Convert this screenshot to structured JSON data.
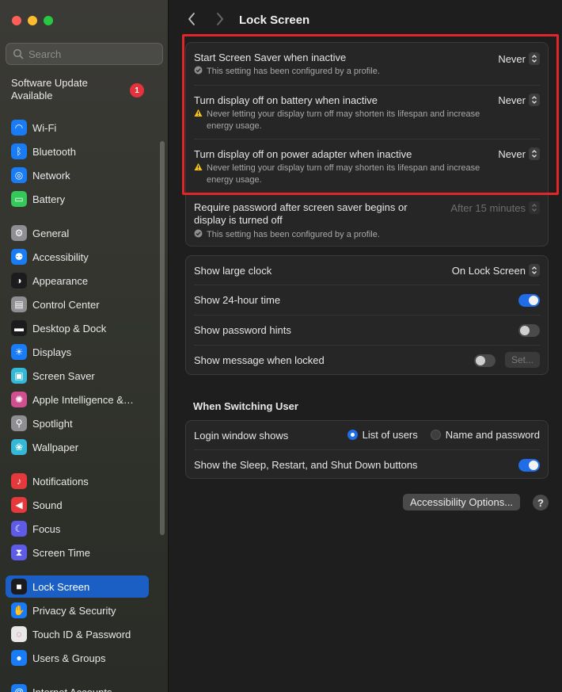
{
  "window": {
    "title": "Lock Screen"
  },
  "search": {
    "placeholder": "Search"
  },
  "software_update": {
    "label": "Software Update Available",
    "badge_count": "1"
  },
  "sidebar": {
    "items": [
      {
        "label": "Wi-Fi",
        "icon": "wifi-icon",
        "color": "#1a7cf5"
      },
      {
        "label": "Bluetooth",
        "icon": "bluetooth-icon",
        "color": "#1a7cf5"
      },
      {
        "label": "Network",
        "icon": "globe-icon",
        "color": "#1a7cf5"
      },
      {
        "label": "Battery",
        "icon": "battery-icon",
        "color": "#34c759"
      },
      {
        "label": "General",
        "icon": "gear-icon",
        "color": "#8e8e93"
      },
      {
        "label": "Accessibility",
        "icon": "accessibility-icon",
        "color": "#1a7cf5"
      },
      {
        "label": "Appearance",
        "icon": "appearance-icon",
        "color": "#1c1c1e"
      },
      {
        "label": "Control Center",
        "icon": "control-center-icon",
        "color": "#8e8e93"
      },
      {
        "label": "Desktop & Dock",
        "icon": "dock-icon",
        "color": "#1c1c1e"
      },
      {
        "label": "Displays",
        "icon": "sun-icon",
        "color": "#1a7cf5"
      },
      {
        "label": "Screen Saver",
        "icon": "screen-saver-icon",
        "color": "#35b8d6"
      },
      {
        "label": "Apple Intelligence &…",
        "icon": "apple-intelligence-icon",
        "color": "#d0508f"
      },
      {
        "label": "Spotlight",
        "icon": "magnifier-icon",
        "color": "#8e8e93"
      },
      {
        "label": "Wallpaper",
        "icon": "flower-icon",
        "color": "#35b8d6"
      },
      {
        "label": "Notifications",
        "icon": "bell-icon",
        "color": "#e5393b"
      },
      {
        "label": "Sound",
        "icon": "speaker-icon",
        "color": "#e5393b"
      },
      {
        "label": "Focus",
        "icon": "moon-icon",
        "color": "#5e5ce6"
      },
      {
        "label": "Screen Time",
        "icon": "hourglass-icon",
        "color": "#5e5ce6"
      },
      {
        "label": "Lock Screen",
        "icon": "lock-icon",
        "color": "#1c1c1e"
      },
      {
        "label": "Privacy & Security",
        "icon": "hand-icon",
        "color": "#1a7cf5"
      },
      {
        "label": "Touch ID & Password",
        "icon": "fingerprint-icon",
        "color": "#e8e8e8"
      },
      {
        "label": "Users & Groups",
        "icon": "users-icon",
        "color": "#1a7cf5"
      },
      {
        "label": "Internet Accounts",
        "icon": "at-icon",
        "color": "#1a7cf5"
      }
    ]
  },
  "lock_group": {
    "screen_saver": {
      "label": "Start Screen Saver when inactive",
      "note": "This setting has been configured by a profile.",
      "value": "Never"
    },
    "display_battery": {
      "label": "Turn display off on battery when inactive",
      "note": "Never letting your display turn off may shorten its lifespan and increase energy usage.",
      "value": "Never"
    },
    "display_power": {
      "label": "Turn display off on power adapter when inactive",
      "note": "Never letting your display turn off may shorten its lifespan and increase energy usage.",
      "value": "Never"
    },
    "require_password": {
      "label": "Require password after screen saver begins or display is turned off",
      "note": "This setting has been configured by a profile.",
      "value": "After 15 minutes"
    }
  },
  "clock_group": {
    "large_clock": {
      "label": "Show large clock",
      "value": "On Lock Screen"
    },
    "hour24": {
      "label": "Show 24-hour time",
      "on": true
    },
    "password_hints": {
      "label": "Show password hints",
      "on": false
    },
    "message_locked": {
      "label": "Show message when locked",
      "on": false,
      "set_label": "Set..."
    }
  },
  "switching": {
    "title": "When Switching User",
    "login_window": {
      "label": "Login window shows",
      "options": [
        "List of users",
        "Name and password"
      ],
      "selected": "List of users"
    },
    "sleep_buttons": {
      "label": "Show the Sleep, Restart, and Shut Down buttons",
      "on": true
    }
  },
  "footer": {
    "accessibility_options": "Accessibility Options...",
    "help": "?"
  },
  "colors": {
    "accent": "#1f6ee8",
    "highlight": "#e0262a",
    "badge": "#e5323b"
  }
}
